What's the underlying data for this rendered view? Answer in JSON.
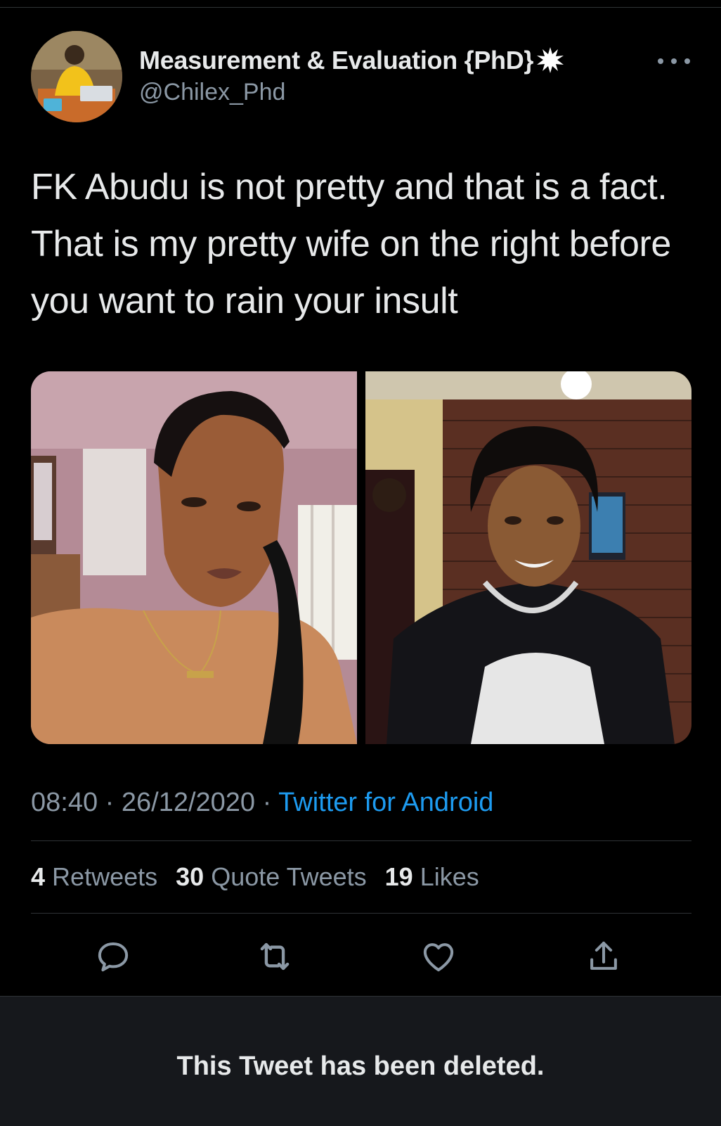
{
  "author": {
    "display_name": "Measurement & Evaluation {PhD}",
    "handle": "@Chilex_Phd",
    "avatar_icon": "profile-photo",
    "badge_icon": "burst-icon"
  },
  "tweet": {
    "text": "FK Abudu is not pretty and that is a fact. That is my pretty wife on the right before you want to rain your insult",
    "media": [
      {
        "icon": "photo-woman-selfie-left"
      },
      {
        "icon": "photo-woman-smiling-right"
      }
    ]
  },
  "meta": {
    "time": "08:40",
    "separator": "·",
    "date": "26/12/2020",
    "source": "Twitter for Android"
  },
  "stats": {
    "retweets": {
      "count": "4",
      "label": "Retweets"
    },
    "quotes": {
      "count": "30",
      "label": "Quote Tweets"
    },
    "likes": {
      "count": "19",
      "label": "Likes"
    }
  },
  "actions": {
    "reply": "reply-icon",
    "retweet": "retweet-icon",
    "like": "heart-icon",
    "share": "share-icon"
  },
  "deleted_notice": "This Tweet has been deleted.",
  "colors": {
    "background": "#000000",
    "text_primary": "#e7e9ea",
    "text_secondary": "#8b98a5",
    "accent": "#1d9bf0",
    "divider": "#2f3336",
    "banner": "#16181c"
  }
}
